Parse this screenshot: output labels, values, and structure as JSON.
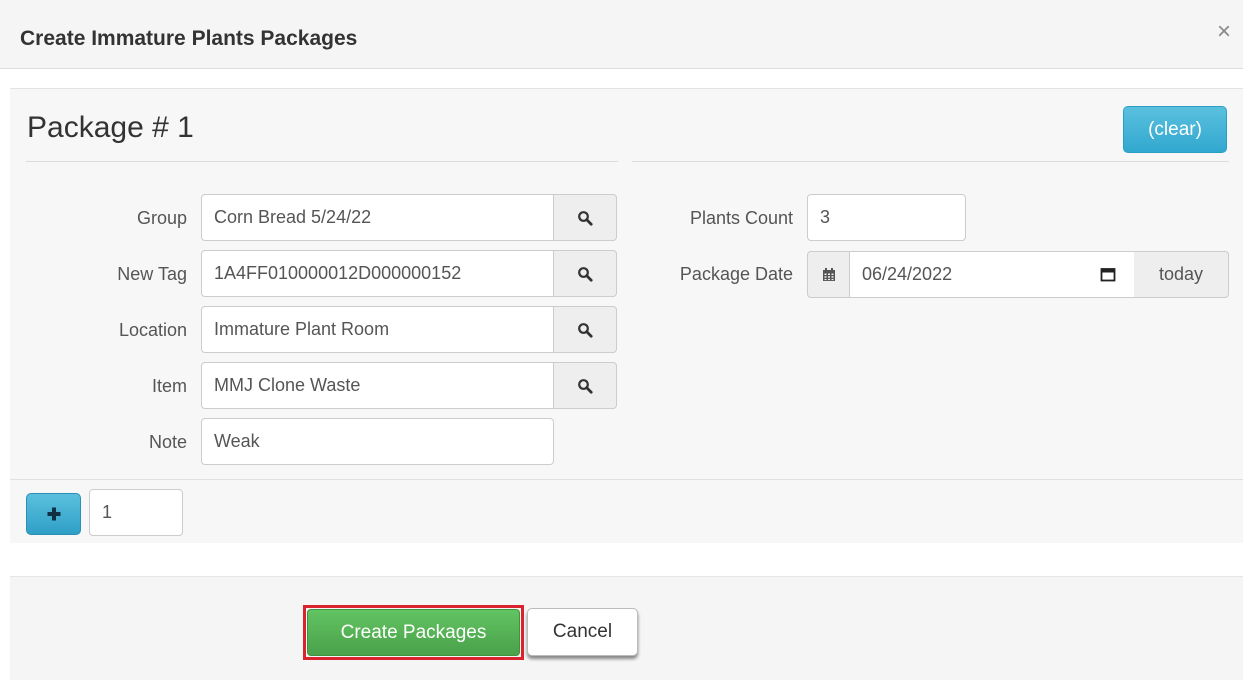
{
  "modal": {
    "title": "Create Immature Plants Packages",
    "close_glyph": "×"
  },
  "package": {
    "title": "Package # 1",
    "clear_label": "(clear)"
  },
  "fields": {
    "group": {
      "label": "Group",
      "value": "Corn Bread 5/24/22"
    },
    "new_tag": {
      "label": "New Tag",
      "value": "1A4FF010000012D000000152"
    },
    "location": {
      "label": "Location",
      "value": "Immature Plant Room"
    },
    "item": {
      "label": "Item",
      "value": "MMJ Clone Waste"
    },
    "note": {
      "label": "Note",
      "value": "Weak"
    },
    "plants_count": {
      "label": "Plants Count",
      "value": "3"
    },
    "package_date": {
      "label": "Package Date",
      "value": "06/24/2022",
      "today_label": "today"
    }
  },
  "add_row": {
    "count": "1"
  },
  "footer": {
    "create_label": "Create Packages",
    "cancel_label": "Cancel"
  },
  "icons": {
    "search": "search-icon",
    "calendar_addon": "calendar-icon",
    "date_picker": "calendar-picker-icon",
    "plus": "plus-icon",
    "close": "close-icon"
  },
  "colors": {
    "info_button": "#5bc0de",
    "success_button": "#5cb85c",
    "highlight_border": "#d9232f"
  }
}
